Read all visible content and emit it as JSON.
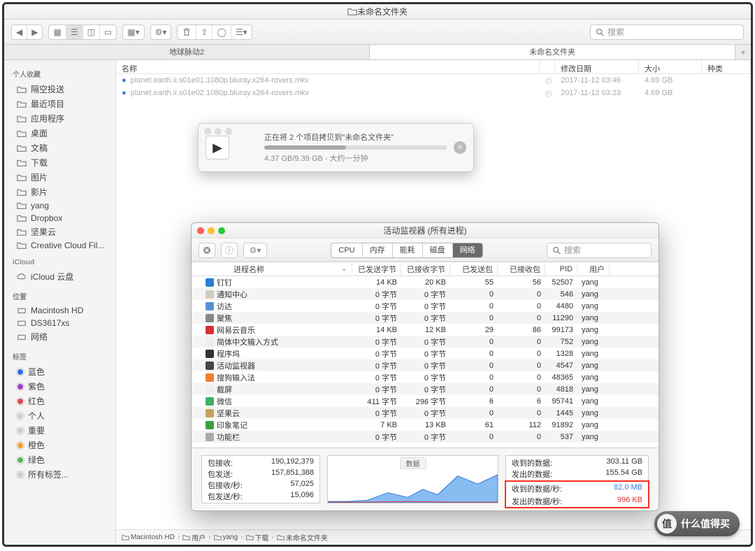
{
  "window_title": "未命名文件夹",
  "search_placeholder": "搜索",
  "tabs": {
    "t1": "地球脉动2",
    "t2": "未命名文件夹"
  },
  "sidebar": {
    "fav_hdr": "个人收藏",
    "fav": [
      "隔空投送",
      "最近项目",
      "应用程序",
      "桌面",
      "文稿",
      "下载",
      "图片",
      "影片",
      "yang",
      "Dropbox",
      "坚果云",
      "Creative Cloud Fil..."
    ],
    "icloud_hdr": "iCloud",
    "icloud": [
      "iCloud 云盘"
    ],
    "loc_hdr": "位置",
    "loc": [
      "Macintosh HD",
      "DS3617xs",
      "网络"
    ],
    "tags_hdr": "标签",
    "tags": [
      {
        "c": "#2f6fe0",
        "t": "蓝色"
      },
      {
        "c": "#9a3ad0",
        "t": "紫色"
      },
      {
        "c": "#e04545",
        "t": "红色"
      },
      {
        "c": "#ccc",
        "t": "个人"
      },
      {
        "c": "#ccc",
        "t": "重要"
      },
      {
        "c": "#f0a030",
        "t": "橙色"
      },
      {
        "c": "#58b558",
        "t": "绿色"
      },
      {
        "c": "#ccc",
        "t": "所有标签..."
      }
    ]
  },
  "file_hdr": {
    "name": "名称",
    "date": "修改日期",
    "size": "大小",
    "kind": "种类"
  },
  "files": [
    {
      "n": "planet.earth.ii.s01e01.1080p.bluray.x264-rovers.mkv",
      "d": "2017-11-12 03:46",
      "s": "4.69 GB"
    },
    {
      "n": "planet.earth.ii.s01e02.1080p.bluray.x264-rovers.mkv",
      "d": "2017-11-12 03:23",
      "s": "4.69 GB"
    }
  ],
  "pathbar": [
    "Macintosh HD",
    "用户",
    "yang",
    "下载",
    "未命名文件夹"
  ],
  "copy": {
    "title": "正在将 2 个项目拷贝到\"未命名文件夹\"",
    "detail": "4.37 GB/9.39 GB - 大约一分钟"
  },
  "am": {
    "title": "活动监视器 (所有进程)",
    "tabs": [
      "CPU",
      "内存",
      "能耗",
      "磁盘",
      "网络"
    ],
    "headers": [
      "进程名称",
      "已发送字节",
      "已接收字节",
      "已发送包",
      "已接收包",
      "PID",
      "用户"
    ],
    "rows": [
      {
        "ic": "#2e7dd6",
        "n": "钉钉",
        "sb": "14 KB",
        "rb": "20 KB",
        "sp": "55",
        "rp": "56",
        "pid": "52507",
        "u": "yang"
      },
      {
        "ic": "#d0cac0",
        "n": "通知中心",
        "sb": "0 字节",
        "rb": "0 字节",
        "sp": "0",
        "rp": "0",
        "pid": "546",
        "u": "yang"
      },
      {
        "ic": "#5a90d8",
        "n": "访达",
        "sb": "0 字节",
        "rb": "0 字节",
        "sp": "0",
        "rp": "0",
        "pid": "4480",
        "u": "yang"
      },
      {
        "ic": "#888",
        "n": "聚焦",
        "sb": "0 字节",
        "rb": "0 字节",
        "sp": "0",
        "rp": "0",
        "pid": "11290",
        "u": "yang"
      },
      {
        "ic": "#d83030",
        "n": "网易云音乐",
        "sb": "14 KB",
        "rb": "12 KB",
        "sp": "29",
        "rp": "86",
        "pid": "99173",
        "u": "yang"
      },
      {
        "ic": "#eee",
        "n": "简体中文输入方式",
        "sb": "0 字节",
        "rb": "0 字节",
        "sp": "0",
        "rp": "0",
        "pid": "752",
        "u": "yang"
      },
      {
        "ic": "#333",
        "n": "程序坞",
        "sb": "0 字节",
        "rb": "0 字节",
        "sp": "0",
        "rp": "0",
        "pid": "1328",
        "u": "yang"
      },
      {
        "ic": "#444",
        "n": "活动监视器",
        "sb": "0 字节",
        "rb": "0 字节",
        "sp": "0",
        "rp": "0",
        "pid": "4547",
        "u": "yang"
      },
      {
        "ic": "#f08030",
        "n": "搜狗输入法",
        "sb": "0 字节",
        "rb": "0 字节",
        "sp": "0",
        "rp": "0",
        "pid": "48365",
        "u": "yang"
      },
      {
        "ic": "#eee",
        "n": "截屏",
        "sb": "0 字节",
        "rb": "0 字节",
        "sp": "0",
        "rp": "0",
        "pid": "4818",
        "u": "yang"
      },
      {
        "ic": "#40b060",
        "n": "微信",
        "sb": "411 字节",
        "rb": "296 字节",
        "sp": "6",
        "rp": "6",
        "pid": "95741",
        "u": "yang"
      },
      {
        "ic": "#c8a060",
        "n": "坚果云",
        "sb": "0 字节",
        "rb": "0 字节",
        "sp": "0",
        "rp": "0",
        "pid": "1445",
        "u": "yang"
      },
      {
        "ic": "#3aa040",
        "n": "印象笔记",
        "sb": "7 KB",
        "rb": "13 KB",
        "sp": "61",
        "rp": "112",
        "pid": "91892",
        "u": "yang"
      },
      {
        "ic": "#aaa",
        "n": "功能栏",
        "sb": "0 字节",
        "rb": "0 字节",
        "sp": "0",
        "rp": "0",
        "pid": "537",
        "u": "yang"
      }
    ],
    "stats_left": [
      {
        "l": "包接收:",
        "v": "190,192,379"
      },
      {
        "l": "包发送:",
        "v": "157,851,388"
      },
      {
        "l": "包接收/秒:",
        "v": "57,025"
      },
      {
        "l": "包发送/秒:",
        "v": "15,096"
      }
    ],
    "graph_label": "数据",
    "stats_right": [
      {
        "l": "收到的数据:",
        "v": "303.11 GB",
        "col": "#333"
      },
      {
        "l": "发出的数据:",
        "v": "155.54 GB",
        "col": "#333"
      }
    ],
    "stats_hl": [
      {
        "l": "收到的数据/秒:",
        "v": "82.0 MB",
        "col": "#2e7dd6"
      },
      {
        "l": "发出的数据/秒:",
        "v": "996 KB",
        "col": "#d83030"
      }
    ]
  },
  "badge_text": "什么值得买"
}
